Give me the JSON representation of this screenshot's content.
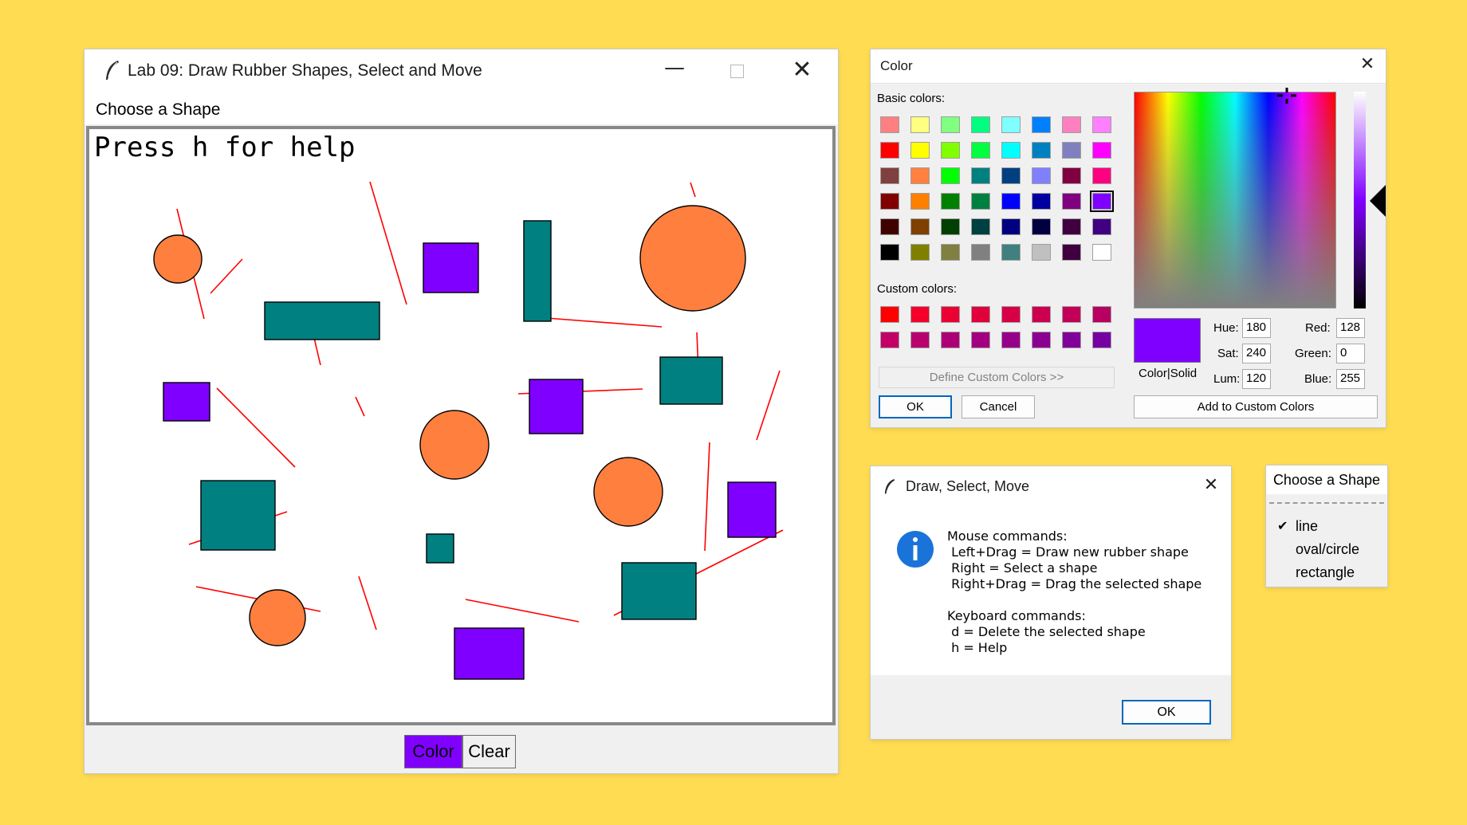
{
  "main_window": {
    "title": "Lab 09: Draw Rubber Shapes, Select and Move",
    "menu": "Choose a Shape",
    "canvas_text": "Press h for help",
    "buttons": {
      "color": "Color",
      "clear": "Clear"
    },
    "colors": {
      "orange": "#FF7F3F",
      "teal": "#008080",
      "purple": "#8000FF",
      "line": "#FF0000"
    }
  },
  "color_dialog": {
    "title": "Color",
    "basic_colors_label": "Basic colors:",
    "custom_colors_label": "Custom colors:",
    "define_custom_label": "Define Custom Colors >>",
    "ok_label": "OK",
    "cancel_label": "Cancel",
    "add_custom_label": "Add to Custom Colors",
    "color_solid_label": "Color|Solid",
    "hue_label": "Hue:",
    "hue": "180",
    "sat_label": "Sat:",
    "sat": "240",
    "lum_label": "Lum:",
    "lum": "120",
    "red_label": "Red:",
    "red": "128",
    "green_label": "Green:",
    "green": "0",
    "blue_label": "Blue:",
    "blue": "255",
    "basic_colors": [
      [
        "#FF8080",
        "#FFFF80",
        "#80FF80",
        "#00FF80",
        "#80FFFF",
        "#0080FF",
        "#FF80C0",
        "#FF80FF"
      ],
      [
        "#FF0000",
        "#FFFF00",
        "#80FF00",
        "#00FF40",
        "#00FFFF",
        "#0080C0",
        "#8080C0",
        "#FF00FF"
      ],
      [
        "#804040",
        "#FF8040",
        "#00FF00",
        "#008080",
        "#004080",
        "#8080FF",
        "#800040",
        "#FF0080"
      ],
      [
        "#800000",
        "#FF8000",
        "#008000",
        "#008040",
        "#0000FF",
        "#0000A0",
        "#800080",
        "#8000FF"
      ],
      [
        "#400000",
        "#804000",
        "#004000",
        "#004040",
        "#000080",
        "#000040",
        "#400040",
        "#400080"
      ],
      [
        "#000000",
        "#808000",
        "#808040",
        "#808080",
        "#408080",
        "#C0C0C0",
        "#400040",
        "#FFFFFF"
      ]
    ],
    "custom_colors": [
      [
        "#FF0000",
        "#F5002A",
        "#EB0033",
        "#E1003C",
        "#D70046",
        "#CC004F",
        "#C20058",
        "#B80062"
      ],
      [
        "#C30066",
        "#B8006E",
        "#AD0077",
        "#A20080",
        "#970088",
        "#8C0091",
        "#810099",
        "#7600A2"
      ]
    ],
    "selected_color": "#8000FF"
  },
  "help_dialog": {
    "title": "Draw, Select, Move",
    "lines": [
      "Mouse commands:",
      " Left+Drag = Draw new rubber shape",
      " Right = Select a shape",
      " Right+Drag = Drag the selected shape",
      "",
      "Keyboard commands:",
      " d = Delete the selected shape",
      " h = Help"
    ],
    "ok_label": "OK"
  },
  "shape_menu": {
    "title": "Choose a Shape",
    "items": [
      "line",
      "oval/circle",
      "rectangle"
    ],
    "checked": "line"
  }
}
